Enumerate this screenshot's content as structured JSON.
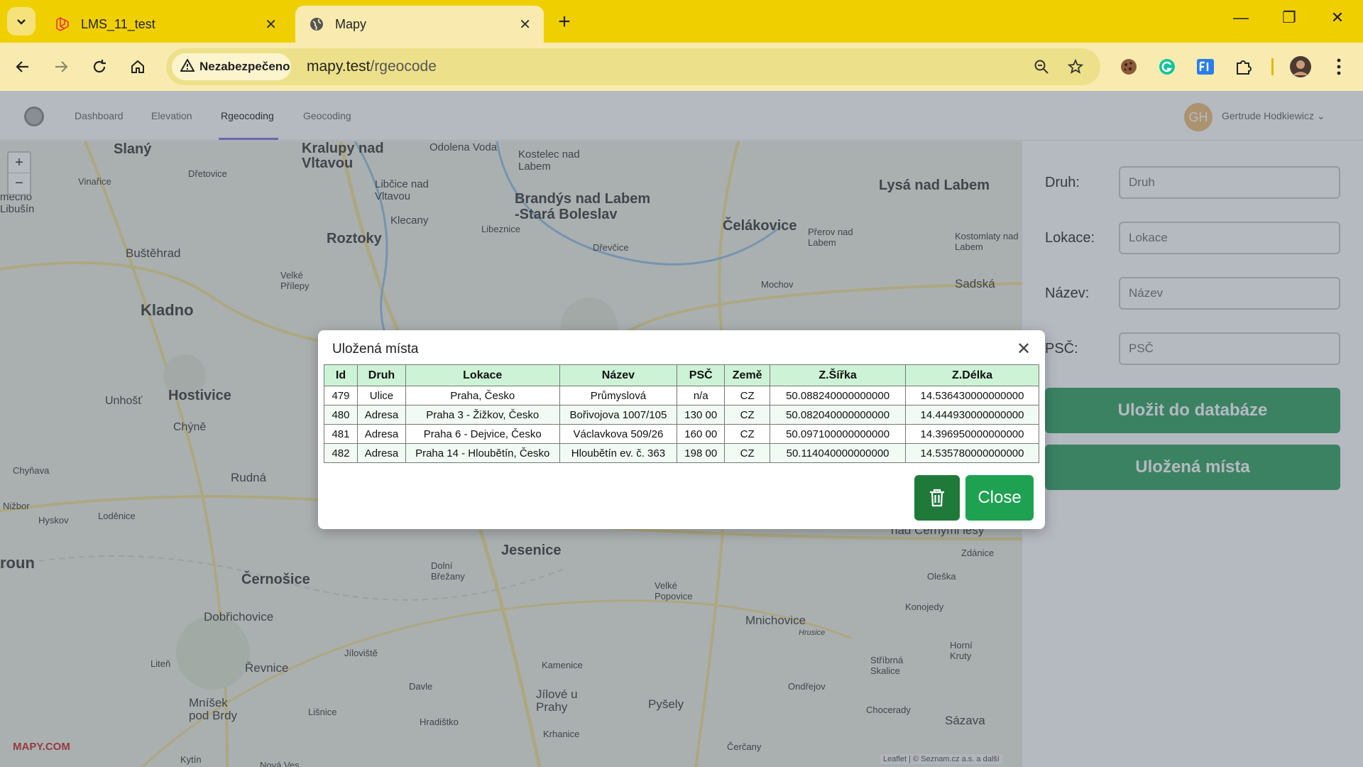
{
  "browser": {
    "tabs": [
      {
        "title": "LMS_11_test"
      },
      {
        "title": "Mapy"
      }
    ],
    "security_label": "Nezabezpečeno",
    "url_host": "mapy.test",
    "url_path": "/rgeocode"
  },
  "app": {
    "nav": [
      "Dashboard",
      "Elevation",
      "Rgeocoding",
      "Geocoding"
    ],
    "user_initials": "GH",
    "user_name": "Gertrude Hodkiewicz"
  },
  "map": {
    "brand": "MAPY.COM",
    "attribution": "Leaflet | © Seznam.cz a.s. a další",
    "labels": [
      "Slaný",
      "Kralupy nad Vltavou",
      "Odolena Voda",
      "Kostelec nad Labem",
      "Brandýs nad Labem -Stará Boleslav",
      "Lysá nad Labem",
      "Libčice nad Vltavou",
      "Klecany",
      "Roztoky",
      "Čelákovice",
      "Buštěhrad",
      "Kladno",
      "Hostivice",
      "Unhošť",
      "Chýně",
      "Rudná",
      "Jesenice",
      "Černošice",
      "Dobřichovice",
      "Řevnice",
      "Mnichovice",
      "Jílové u Prahy",
      "Pyšely",
      "Mníšek pod Brdy",
      "Sázava",
      "Sadská",
      "Mochov",
      "Zdánice",
      "Loděnice",
      "Hyskov",
      "roun",
      "Velké Přílepy",
      "Dřevčice",
      "Libeznice",
      "Přerov nad Labem",
      "Kostomlaty nad Labem",
      "Dolní Břežany",
      "Kamenice",
      "Velké Popovice",
      "Ondřejov",
      "Konojedy",
      "Hradištko",
      "Krhanice",
      "Čerčany",
      "Davle",
      "Lišnice",
      "Jíloviště",
      "Liteň",
      "Vinařice",
      "Libušín",
      "Dřetovice",
      "Chyňava",
      "Nižbor",
      "Kytín",
      "Nová Ves",
      "Stříbrná Skalice",
      "Chocerady",
      "Oleška",
      "Hrusice",
      "Horní Kruty",
      "nad Černými lesy",
      "mecno"
    ]
  },
  "form": {
    "fields": [
      {
        "label": "Druh:",
        "placeholder": "Druh"
      },
      {
        "label": "Lokace:",
        "placeholder": "Lokace"
      },
      {
        "label": "Název:",
        "placeholder": "Název"
      },
      {
        "label": "PSČ:",
        "placeholder": "PSČ"
      }
    ],
    "save_button": "Uložit do databáze",
    "saved_button": "Uložená místa"
  },
  "modal": {
    "title": "Uložená místa",
    "columns": [
      "Id",
      "Druh",
      "Lokace",
      "Název",
      "PSČ",
      "Země",
      "Z.Šířka",
      "Z.Délka"
    ],
    "rows": [
      [
        "479",
        "Ulice",
        "Praha, Česko",
        "Průmyslová",
        "n/a",
        "CZ",
        "50.088240000000000",
        "14.536430000000000"
      ],
      [
        "480",
        "Adresa",
        "Praha 3 - Žižkov, Česko",
        "Bořivojova 1007/105",
        "130 00",
        "CZ",
        "50.082040000000000",
        "14.444930000000000"
      ],
      [
        "481",
        "Adresa",
        "Praha 6 - Dejvice, Česko",
        "Václavkova 509/26",
        "160 00",
        "CZ",
        "50.097100000000000",
        "14.396950000000000"
      ],
      [
        "482",
        "Adresa",
        "Praha 14 - Hloubětín, Česko",
        "Hloubětín ev. č. 363",
        "198 00",
        "CZ",
        "50.114040000000000",
        "14.535780000000000"
      ]
    ],
    "close_label": "Close"
  },
  "colors": {
    "chrome": "#f0cf00",
    "toolbar": "#f9ebb0",
    "header_green": "#cdf3d6",
    "btn_green": "#1fa152",
    "btn_dark_green": "#1f7a3a",
    "side_btn": "#3aa66a"
  }
}
